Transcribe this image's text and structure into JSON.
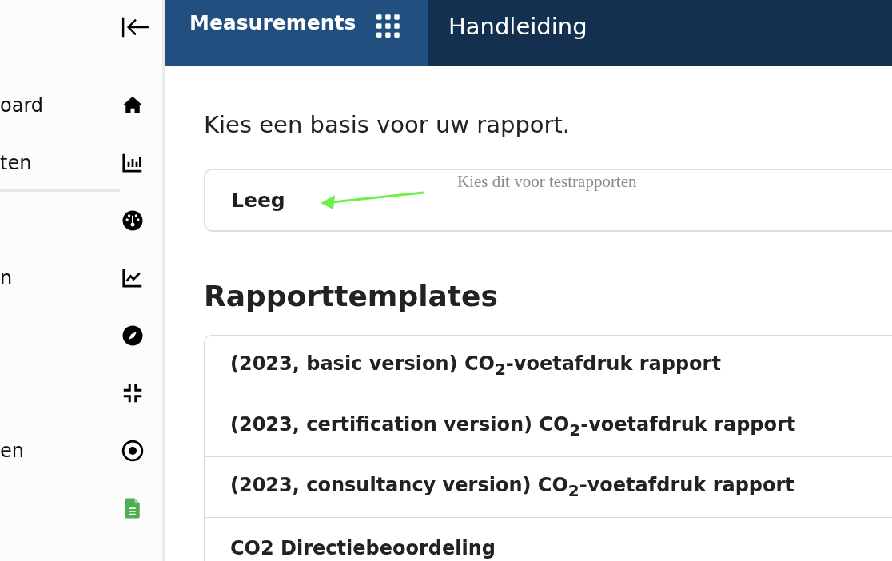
{
  "sidebar": {
    "items": [
      {
        "label": "oard",
        "selected": false
      },
      {
        "label": "ten",
        "selected": true
      },
      {
        "selected": false
      },
      {
        "label": "n",
        "selected": false
      },
      {
        "selected": false
      },
      {
        "selected": false
      },
      {
        "label": "en",
        "selected": false
      },
      {
        "selected": false
      }
    ]
  },
  "header": {
    "tabs": [
      {
        "label": "Measurements",
        "selected": true
      },
      {
        "label": "Handleiding",
        "selected": false
      }
    ]
  },
  "main": {
    "prompt": "Kies een basis voor uw rapport.",
    "empty_option": "Leeg",
    "annotation": "Kies dit voor testrapporten",
    "section_title": "Rapporttemplates",
    "templates": [
      "(2023, basic version) CO$_{2}$-voetafdruk rapport",
      "(2023, certification version) CO$_{2}$-voetafdruk rapport",
      "(2023, consultancy version) CO$_{2}$-voetafdruk rapport",
      "CO2 Directiebeoordeling"
    ]
  }
}
